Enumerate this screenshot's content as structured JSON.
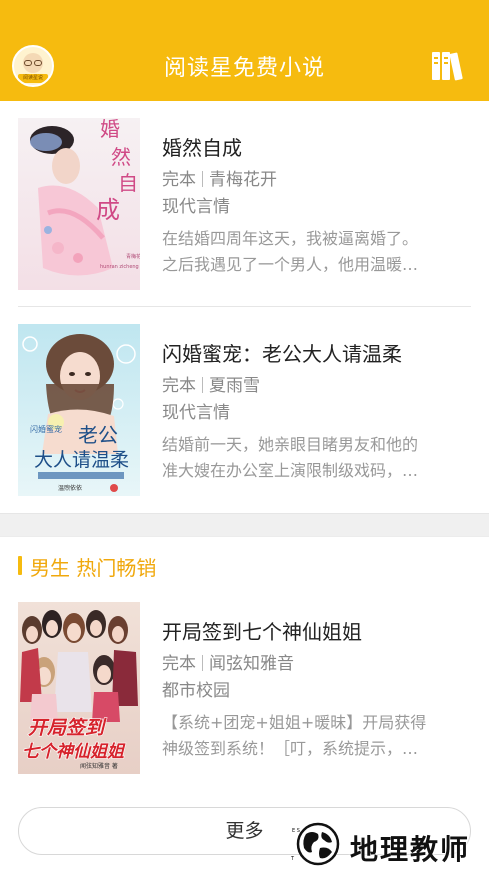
{
  "header": {
    "title": "阅读星免费小说",
    "avatar_text": "阅读星说"
  },
  "books": [
    {
      "title": "婚然自成",
      "status": "完本",
      "author": "青梅花开",
      "genre": "现代言情",
      "desc_line1": "在结婚四周年这天，我被逼离婚了。",
      "desc_line2": "之后我遇见了一个男人，他用温暖…",
      "cover_title": "婚然自成",
      "cover_author": "青梅花开 著",
      "cover_pinyin": "hunran zicheng"
    },
    {
      "title": "闪婚蜜宠：老公大人请温柔",
      "status": "完本",
      "author": "夏雨雪",
      "genre": "现代言情",
      "desc_line1": "结婚前一天，她亲眼目睹男友和他的",
      "desc_line2": "准大嫂在办公室上演限制级戏码，…",
      "cover_title_top": "闪婚蜜宠",
      "cover_title_main": "老公大人请温柔",
      "cover_author": "温煦依依"
    },
    {
      "title": "开局签到七个神仙姐姐",
      "status": "完本",
      "author": "闻弦知雅音",
      "genre": "都市校园",
      "desc_line1": "【系统+团宠+姐姐+暖昧】开局获得",
      "desc_line2": "神级签到系统！［叮，系统提示，…",
      "cover_title_line1": "开局签到",
      "cover_title_line2": "七个神仙姐姐",
      "cover_author": "闻弦知雅音 著"
    }
  ],
  "section": {
    "title": "男生 热门畅销"
  },
  "more_button": "更多",
  "watermark": "地理教师",
  "colors": {
    "brand": "#f6bb0f",
    "section_title": "#f0a80c"
  },
  "icons": {
    "avatar": "reader-avatar-icon",
    "bookshelf": "bookshelf-icon"
  }
}
